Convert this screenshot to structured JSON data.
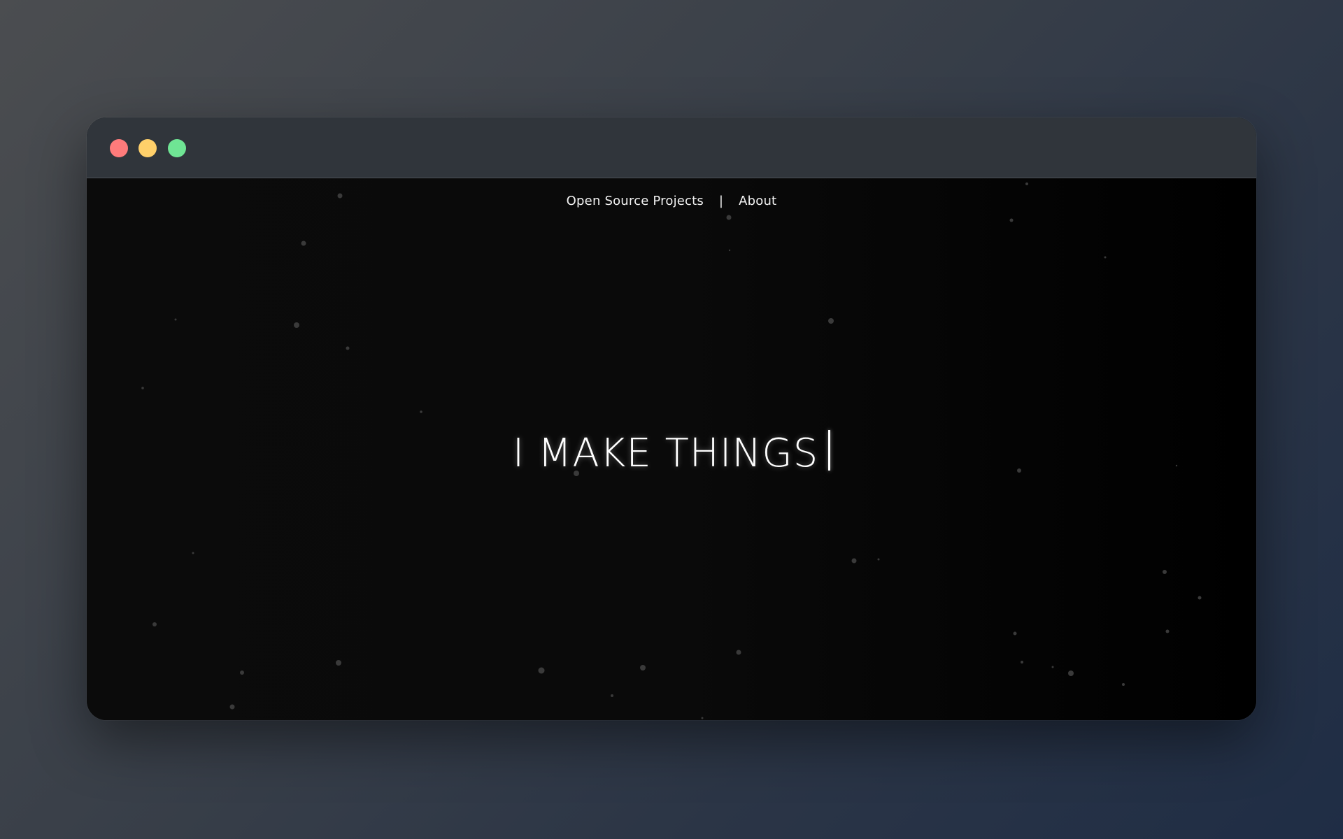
{
  "window": {
    "traffic_lights": {
      "close_color": "#ff7b7b",
      "minimize_color": "#ffd06a",
      "maximize_color": "#6fe594"
    }
  },
  "nav": {
    "items": [
      {
        "label": "Open Source Projects"
      },
      {
        "label": "About"
      }
    ],
    "separator": "|"
  },
  "hero": {
    "headline": "I MAKE THINGS"
  },
  "colors": {
    "background": "#000000",
    "titlebar": "#30353b",
    "text": "#ffffff",
    "particle": "#3a3a3a"
  }
}
